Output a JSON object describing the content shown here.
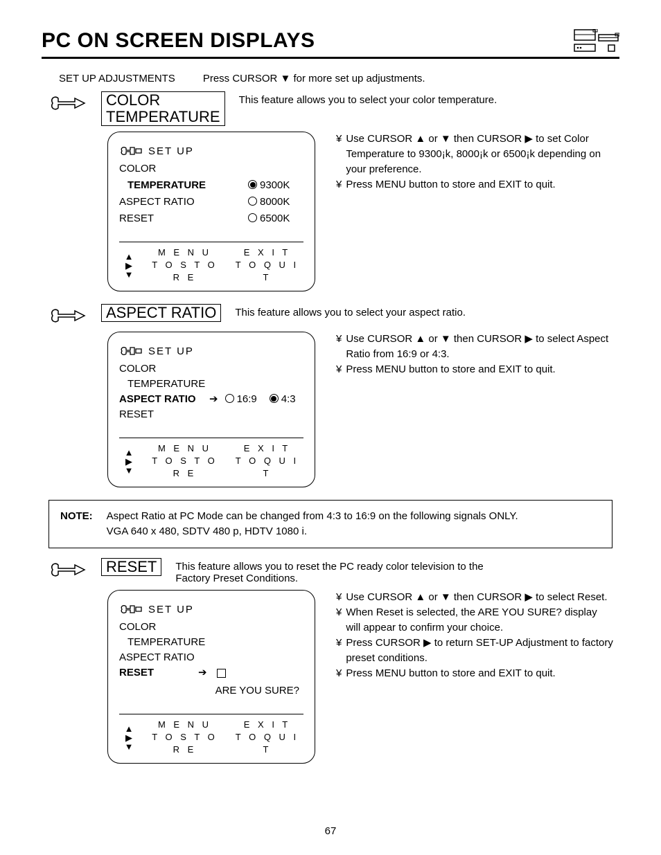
{
  "title": "PC ON SCREEN DISPLAYS",
  "setup_line": {
    "label": "SET UP ADJUSTMENTS",
    "hint": "Press CURSOR ▼ for more set up adjustments."
  },
  "color_temp": {
    "label_l1": "COLOR",
    "label_l2": "TEMPERATURE",
    "desc": "This feature allows you to select your color temperature.",
    "bullets": [
      "Use CURSOR ▲ or ▼ then CURSOR ▶ to set Color Temperature to 9300¡k, 8000¡k or 6500¡k depending on your preference.",
      "Press MENU button to store and EXIT to quit."
    ],
    "screen": {
      "header": "SET UP",
      "items": [
        {
          "l": "COLOR"
        },
        {
          "l": "  TEMPERATURE",
          "bold": true,
          "opt": "9300K",
          "sel": true
        },
        {
          "l": "ASPECT RATIO",
          "opt": "8000K",
          "sel": false
        },
        {
          "l": "RESET",
          "opt": "6500K",
          "sel": false
        }
      ]
    }
  },
  "aspect": {
    "label": "ASPECT RATIO",
    "desc": "This feature allows you to select your aspect ratio.",
    "bullets": [
      "Use CURSOR ▲ or ▼ then CURSOR ▶ to select Aspect Ratio from 16:9 or 4:3.",
      "Press MENU button to store and EXIT to quit."
    ],
    "screen": {
      "header": "SET UP",
      "items": [
        "COLOR",
        "  TEMPERATURE",
        "ASPECT RATIO",
        "RESET"
      ],
      "opts": {
        "a": "16:9",
        "b": "4:3"
      }
    }
  },
  "reset": {
    "label": "RESET",
    "desc": "This feature allows you to reset the PC ready color television to the Factory Preset Conditions.",
    "bullets": [
      "Use CURSOR ▲ or ▼ then CURSOR ▶ to select Reset.",
      "When Reset is selected, the  ARE YOU SURE?  display will appear to confirm your choice.",
      "Press CURSOR ▶ to return SET-UP Adjustment to factory preset conditions.",
      "Press MENU button to store and EXIT to quit."
    ],
    "screen": {
      "header": "SET UP",
      "items": [
        "COLOR",
        "  TEMPERATURE",
        "ASPECT RATIO",
        "RESET"
      ],
      "prompt": "ARE YOU SURE?"
    }
  },
  "note": {
    "label": "NOTE:",
    "lines": [
      "Aspect Ratio at PC Mode can be changed from 4:3 to 16:9 on the following signals ONLY.",
      "VGA 640 x 480, SDTV 480 p, HDTV 1080 i."
    ]
  },
  "footer": {
    "menu_l1": "M E N U",
    "menu_l2": "T O   S T O R E",
    "exit_l1": "E X I T",
    "exit_l2": "T O   Q U I T"
  },
  "bullet_char": "¥",
  "page_number": "67"
}
